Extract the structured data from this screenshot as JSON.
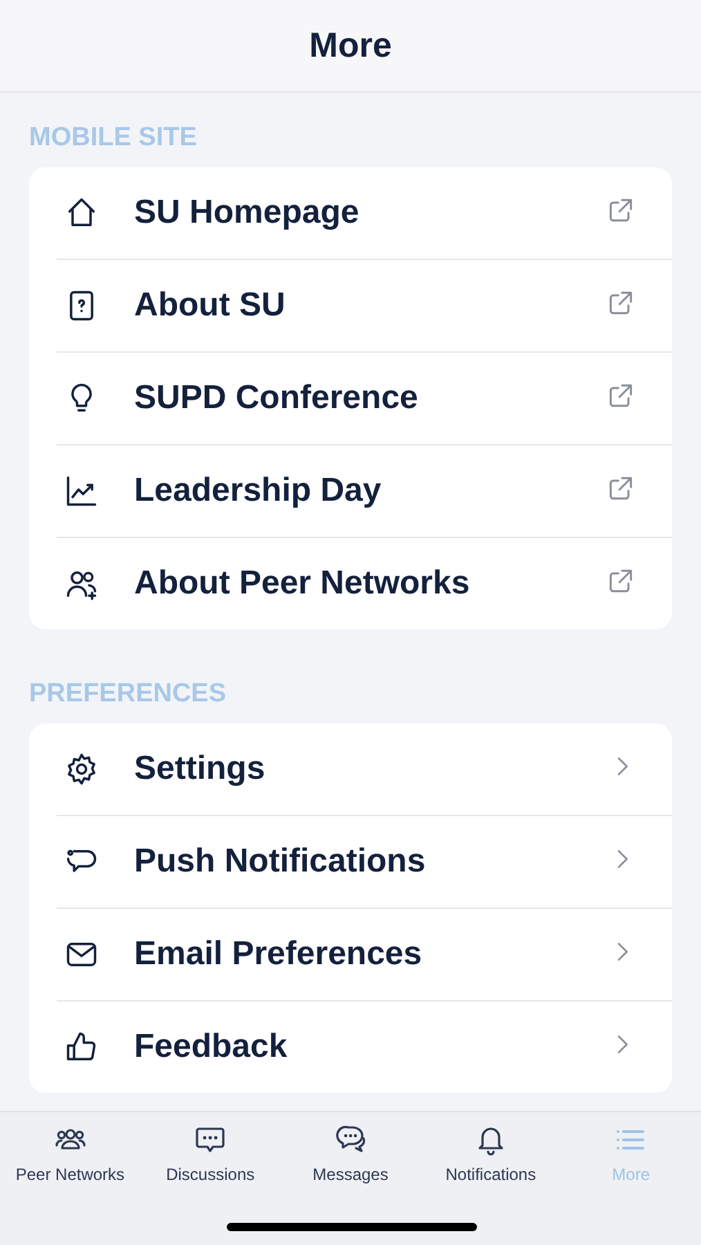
{
  "header": {
    "title": "More"
  },
  "sections": [
    {
      "title": "MOBILE SITE",
      "items": [
        {
          "label": "SU Homepage",
          "kind": "external"
        },
        {
          "label": "About SU",
          "kind": "external"
        },
        {
          "label": "SUPD Conference",
          "kind": "external"
        },
        {
          "label": "Leadership Day",
          "kind": "external"
        },
        {
          "label": "About Peer Networks",
          "kind": "external"
        }
      ]
    },
    {
      "title": "PREFERENCES",
      "items": [
        {
          "label": "Settings",
          "kind": "chevron"
        },
        {
          "label": "Push Notifications",
          "kind": "chevron"
        },
        {
          "label": "Email Preferences",
          "kind": "chevron"
        },
        {
          "label": "Feedback",
          "kind": "chevron"
        }
      ]
    }
  ],
  "tabs": [
    {
      "label": "Peer Networks",
      "selected": false
    },
    {
      "label": "Discussions",
      "selected": false
    },
    {
      "label": "Messages",
      "selected": false
    },
    {
      "label": "Notifications",
      "selected": false
    },
    {
      "label": "More",
      "selected": true
    }
  ]
}
